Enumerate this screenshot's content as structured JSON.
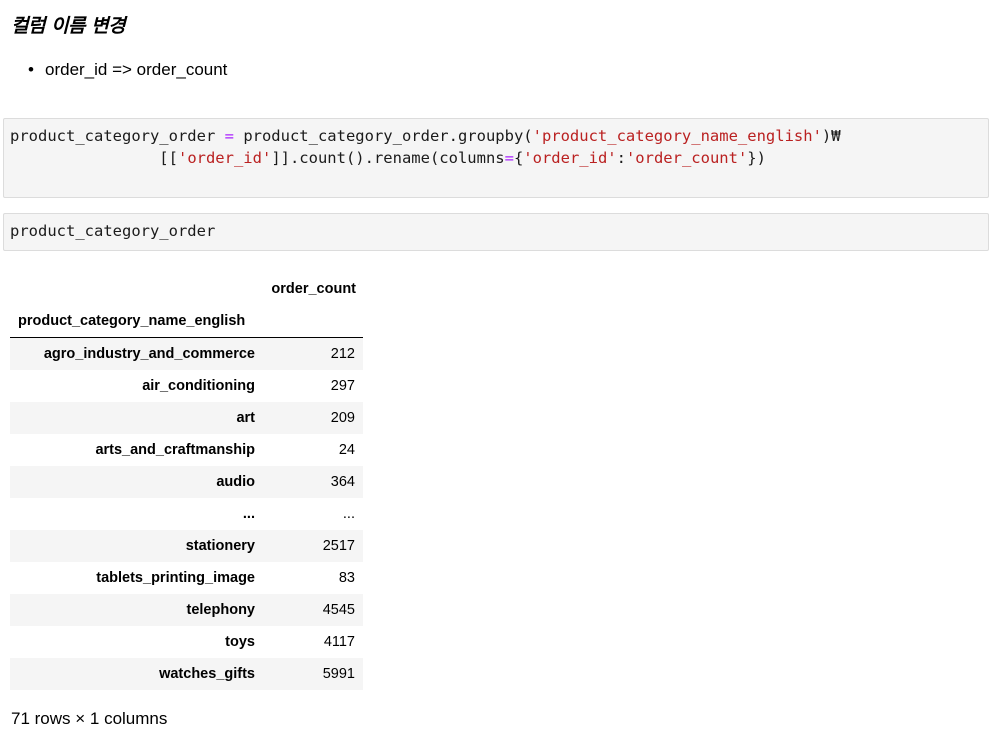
{
  "markdown": {
    "heading": "컬럼 이름 변경",
    "bullet": "order_id => order_count"
  },
  "code_cells": [
    {
      "lines": [
        [
          {
            "t": "product_category_order ",
            "c": ""
          },
          {
            "t": "=",
            "c": "op"
          },
          {
            "t": " product_category_order.groupby(",
            "c": ""
          },
          {
            "t": "'product_category_name_english'",
            "c": "str"
          },
          {
            "t": ")₩",
            "c": ""
          }
        ],
        [
          {
            "t": "                [[",
            "c": ""
          },
          {
            "t": "'order_id'",
            "c": "str"
          },
          {
            "t": "]].count().rename(columns",
            "c": ""
          },
          {
            "t": "=",
            "c": "op"
          },
          {
            "t": "{",
            "c": ""
          },
          {
            "t": "'order_id'",
            "c": "str"
          },
          {
            "t": ":",
            "c": ""
          },
          {
            "t": "'order_count'",
            "c": "str"
          },
          {
            "t": "})",
            "c": ""
          }
        ]
      ]
    },
    {
      "lines": [
        [
          {
            "t": "product_category_order",
            "c": ""
          }
        ]
      ]
    }
  ],
  "dataframe": {
    "column": "order_count",
    "index_name": "product_category_name_english",
    "rows": [
      {
        "index": "agro_industry_and_commerce",
        "value": "212"
      },
      {
        "index": "air_conditioning",
        "value": "297"
      },
      {
        "index": "art",
        "value": "209"
      },
      {
        "index": "arts_and_craftmanship",
        "value": "24"
      },
      {
        "index": "audio",
        "value": "364"
      },
      {
        "index": "...",
        "value": "..."
      },
      {
        "index": "stationery",
        "value": "2517"
      },
      {
        "index": "tablets_printing_image",
        "value": "83"
      },
      {
        "index": "telephony",
        "value": "4545"
      },
      {
        "index": "toys",
        "value": "4117"
      },
      {
        "index": "watches_gifts",
        "value": "5991"
      }
    ],
    "shape_text": "71 rows × 1 columns"
  },
  "colors": {
    "string": "#ba2121",
    "operator": "#aa22ff",
    "cell_background": "#f5f5f5",
    "cell_border": "#dcdcdc"
  }
}
